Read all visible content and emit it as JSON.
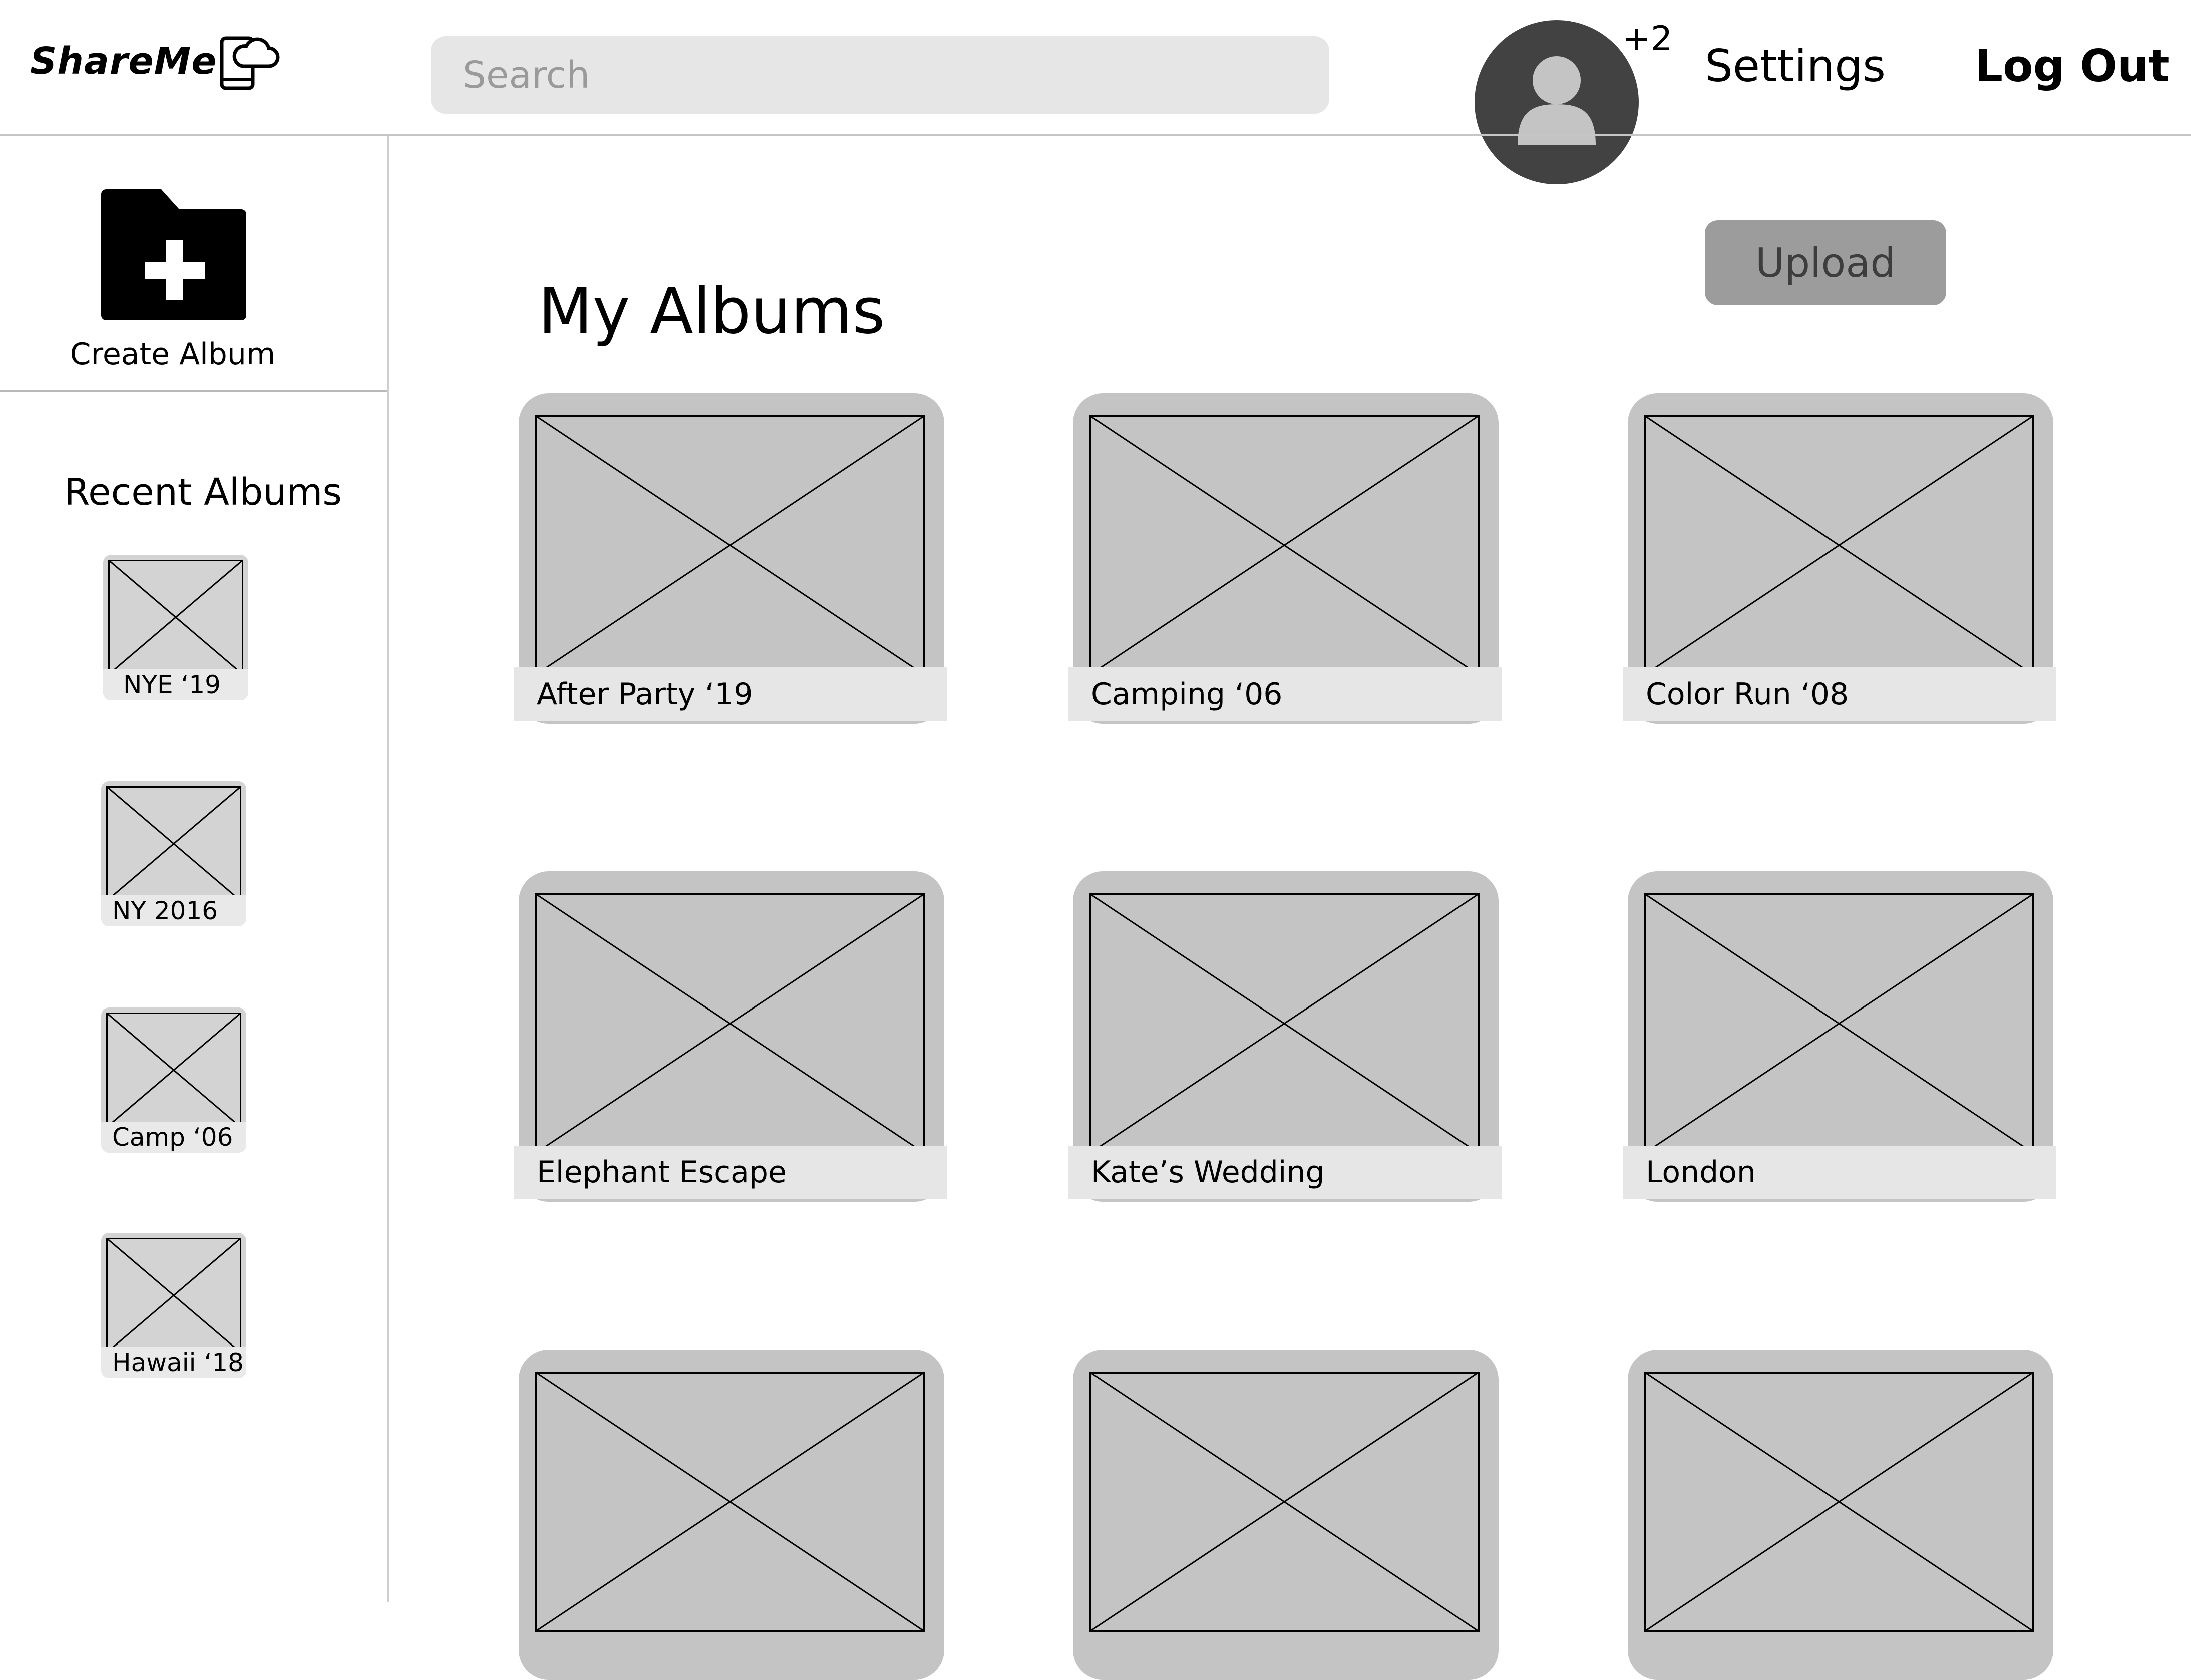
{
  "header": {
    "brand": "ShareMe",
    "brand_icon": "phone-cloud-icon",
    "search_placeholder": "Search",
    "avatar_icon": "user-avatar-icon",
    "notification_count": "+2",
    "settings_label": "Settings",
    "logout_label": "Log Out"
  },
  "sidebar": {
    "create_album_label": "Create Album",
    "create_album_icon": "folder-plus-icon",
    "recent_title": "Recent Albums",
    "recent_albums": [
      "NYE ‘19",
      "NY 2016",
      "Camp ‘06",
      "Hawaii ‘18"
    ]
  },
  "main": {
    "title": "My Albums",
    "upload_label": "Upload",
    "albums": [
      "After Party ‘19",
      "Camping ‘06",
      "Color Run ‘08",
      "Elephant Escape",
      "Kate’s Wedding",
      "London",
      "",
      "",
      ""
    ]
  },
  "colors": {
    "placeholder_tile": "#c4c4c4",
    "label_bar": "#e6e6e6",
    "avatar_bg": "#424242",
    "upload_button": "#9c9c9c"
  }
}
